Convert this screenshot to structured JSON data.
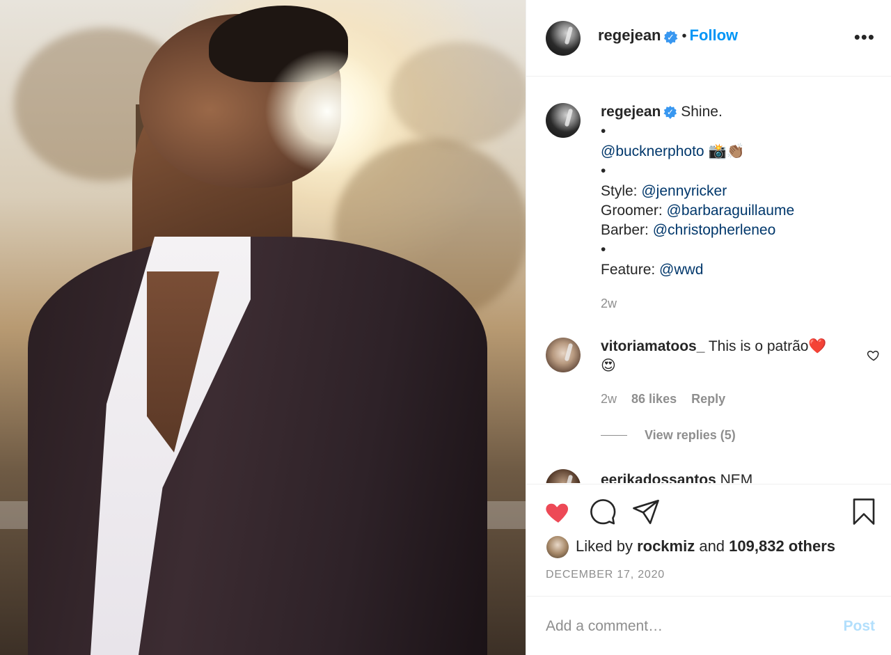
{
  "photo": {
    "alt": ""
  },
  "header": {
    "username": "regejean",
    "verified_glyph": "✓",
    "separator": "•",
    "follow_label": "Follow",
    "more_label": "•••"
  },
  "caption": {
    "username": "regejean",
    "verified_glyph": "✓",
    "lines": [
      {
        "text": "Shine."
      },
      {
        "text": "•"
      },
      {
        "mention": "@bucknerphoto",
        "emoji": "📸👏🏽"
      },
      {
        "text": "•"
      },
      {
        "prefix": "Style: ",
        "mention": "@jennyricker"
      },
      {
        "prefix": "Groomer: ",
        "mention": "@barbaraguillaume"
      },
      {
        "prefix": "Barber: ",
        "mention": "@christopherleneo"
      },
      {
        "text": "•"
      },
      {
        "prefix": "Feature: ",
        "mention": "@wwd"
      }
    ],
    "time": "2w"
  },
  "comments": [
    {
      "username": "vitoriamatoos_",
      "text": "This is o patrão❤️",
      "text2": "😍",
      "time": "2w",
      "likes": "86 likes",
      "reply_label": "Reply",
      "view_replies": "View replies (5)"
    },
    {
      "username": "eerikadossantos",
      "text": "NEM"
    }
  ],
  "actions": {
    "like_icon": "heart-filled-icon",
    "comment_icon": "comment-icon",
    "share_icon": "paper-plane-icon",
    "save_icon": "bookmark-icon",
    "liked_by_prefix": "Liked by ",
    "liked_by_user": "rockmiz",
    "liked_by_and": " and ",
    "liked_by_others": "109,832 others",
    "date": "DECEMBER 17, 2020"
  },
  "composer": {
    "placeholder": "Add a comment…",
    "post_label": "Post"
  },
  "colors": {
    "link_blue": "#0095f6",
    "mention_blue": "#00376b",
    "like_red": "#ed4956",
    "muted": "#8e8e8e",
    "post_disabled": "#b2dffc"
  }
}
